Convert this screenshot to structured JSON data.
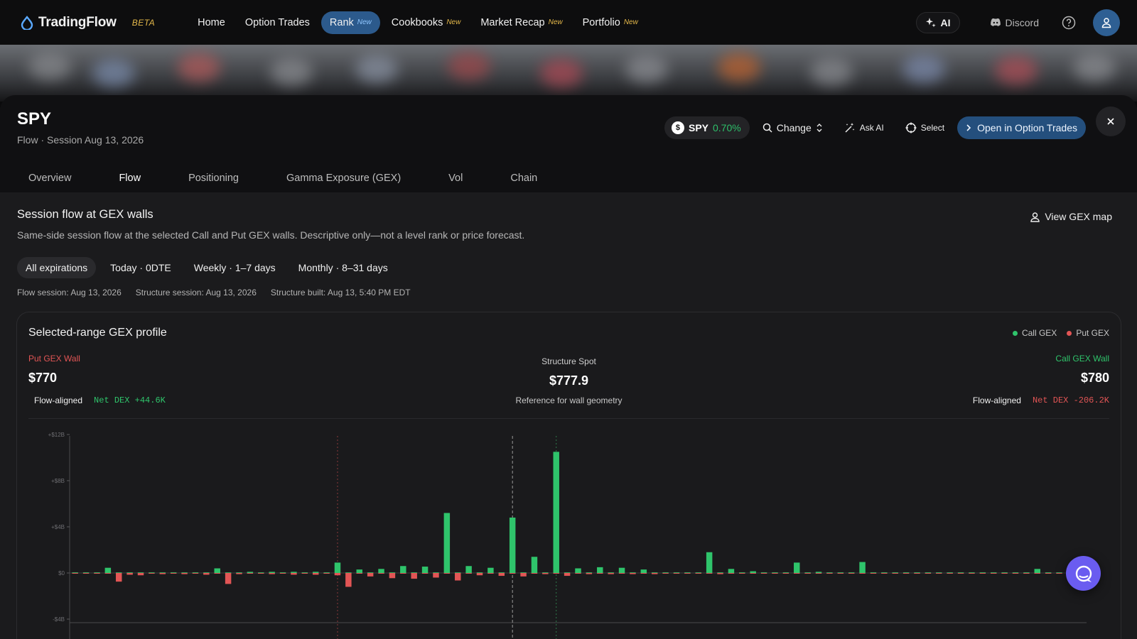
{
  "nav": {
    "brand": "TradingFlow",
    "beta": "BETA",
    "links": [
      {
        "label": "Home",
        "badge": ""
      },
      {
        "label": "Option Trades",
        "badge": ""
      },
      {
        "label": "Rank",
        "badge": "New"
      },
      {
        "label": "Cookbooks",
        "badge": "New"
      },
      {
        "label": "Market Recap",
        "badge": "New"
      },
      {
        "label": "Portfolio",
        "badge": "New"
      }
    ],
    "ai_label": "AI",
    "discord_label": "Discord"
  },
  "panel": {
    "symbol": "SPY",
    "subline": "Flow · Session Aug 13, 2026",
    "chip_symbol": "SPY",
    "chip_change": "0.70%",
    "change_label": "Change",
    "ask_ai_label": "Ask AI",
    "select_label": "Select",
    "open_label": "Open in Option Trades",
    "tabs": [
      "Overview",
      "Flow",
      "Positioning",
      "Gamma Exposure (GEX)",
      "Vol",
      "Chain"
    ],
    "active_tab": "Flow"
  },
  "section": {
    "title": "Session flow at GEX walls",
    "description": "Same-side session flow at the selected Call and Put GEX walls. Descriptive only—not a level rank or price forecast.",
    "view_gex_label": "View GEX map",
    "filters": [
      "All expirations",
      "Today · 0DTE",
      "Weekly · 1–7 days",
      "Monthly · 8–31 days"
    ],
    "meta": [
      "Flow session: Aug 13, 2026",
      "Structure session: Aug 13, 2026",
      "Structure built: Aug 13, 5:40 PM EDT"
    ]
  },
  "card": {
    "title": "Selected-range GEX profile",
    "legend": [
      {
        "label": "Call GEX",
        "color": "#2fc46b"
      },
      {
        "label": "Put GEX",
        "color": "#e25555"
      }
    ],
    "put_wall": {
      "label": "Put GEX Wall",
      "price": "$770",
      "flow": "Flow-aligned",
      "dex": "Net DEX +44.6K"
    },
    "call_wall": {
      "label": "Call GEX Wall",
      "price": "$780",
      "flow": "Flow-aligned",
      "dex": "Net DEX -206.2K"
    },
    "spot": {
      "label": "Structure Spot",
      "price": "$777.9",
      "note": "Reference for wall geometry"
    }
  },
  "chart_data": {
    "type": "bar",
    "ylabel": "",
    "ylim": [
      -4,
      12
    ],
    "yticks": [
      "+$12B",
      "+$8B",
      "+$4B",
      "$0",
      "-$4B"
    ],
    "ytick_values": [
      12,
      8,
      4,
      0,
      -4
    ],
    "put_wall_index": 24,
    "spot_index": 40,
    "call_wall_index": 44,
    "series": [
      {
        "name": "Call GEX",
        "color": "#2fc46b",
        "values": [
          0.05,
          0.05,
          0.05,
          0.45,
          0.05,
          0.05,
          0.05,
          0.05,
          0.05,
          0.05,
          0.05,
          0.05,
          0.05,
          0.4,
          0.05,
          0.05,
          0.1,
          0.05,
          0.1,
          0.05,
          0.1,
          0.05,
          0.1,
          0.05,
          0.9,
          0.05,
          0.3,
          0.05,
          0.35,
          0.05,
          0.6,
          0.05,
          0.55,
          0.05,
          5.2,
          0.05,
          0.6,
          0.05,
          0.45,
          0.05,
          4.8,
          0.05,
          1.4,
          0.05,
          10.5,
          0.05,
          0.4,
          0.05,
          0.5,
          0.05,
          0.45,
          0.05,
          0.3,
          0.05,
          0.05,
          0.05,
          0.05,
          0.05,
          1.8,
          0.05,
          0.35,
          0.05,
          0.15,
          0.05,
          0.05,
          0.05,
          0.9,
          0.05,
          0.1,
          0.05,
          0.05,
          0.05,
          0.95,
          0.05,
          0.05,
          0.05,
          0.05,
          0.05,
          0.05,
          0.05,
          0.05,
          0.05,
          0.05,
          0.05,
          0.05,
          0.05,
          0.05,
          0.05,
          0.35,
          0.05,
          0.05,
          0.05,
          0.05
        ]
      },
      {
        "name": "Put GEX",
        "color": "#e25555",
        "values": [
          -0.05,
          -0.05,
          -0.05,
          -0.05,
          -0.75,
          -0.15,
          -0.2,
          -0.05,
          -0.1,
          -0.05,
          -0.1,
          -0.05,
          -0.15,
          -0.05,
          -0.95,
          -0.1,
          -0.05,
          -0.05,
          -0.1,
          -0.05,
          -0.15,
          -0.05,
          -0.15,
          -0.05,
          -0.2,
          -1.2,
          -0.05,
          -0.3,
          -0.05,
          -0.45,
          -0.05,
          -0.5,
          -0.05,
          -0.4,
          -0.05,
          -0.65,
          -0.05,
          -0.2,
          -0.05,
          -0.25,
          -0.05,
          -0.3,
          -0.05,
          -0.1,
          -0.05,
          -0.25,
          -0.05,
          -0.1,
          -0.05,
          -0.1,
          -0.05,
          -0.1,
          -0.05,
          -0.1,
          -0.05,
          -0.05,
          -0.05,
          -0.05,
          -0.05,
          -0.1,
          -0.05,
          -0.05,
          -0.05,
          -0.05,
          -0.05,
          -0.05,
          -0.05,
          -0.05,
          -0.05,
          -0.05,
          -0.05,
          -0.05,
          -0.05,
          -0.05,
          -0.05,
          -0.05,
          -0.05,
          -0.05,
          -0.05,
          -0.05,
          -0.05,
          -0.05,
          -0.05,
          -0.05,
          -0.05,
          -0.05,
          -0.05,
          -0.05,
          -0.05,
          -0.05,
          -0.05,
          -0.05,
          -0.05
        ]
      }
    ]
  }
}
